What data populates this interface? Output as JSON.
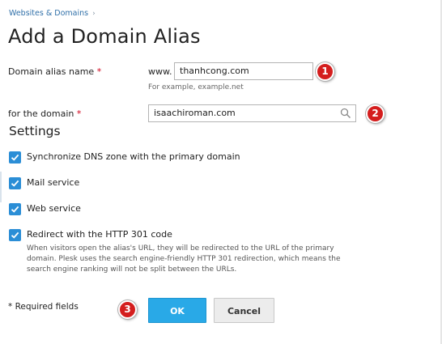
{
  "breadcrumb": {
    "item": "Websites & Domains",
    "separator": "›"
  },
  "page_title": "Add a Domain Alias",
  "alias_field": {
    "label": "Domain alias name",
    "required_mark": "*",
    "prefix": "www.",
    "value": "thanhcong.com",
    "hint": "For example, example.net"
  },
  "domain_field": {
    "label": "for the domain",
    "required_mark": "*",
    "value": "isaachiroman.com",
    "icon": "search-icon"
  },
  "settings": {
    "title": "Settings",
    "options": [
      {
        "label": "Synchronize DNS zone with the primary domain",
        "checked": true
      },
      {
        "label": "Mail service",
        "checked": true
      },
      {
        "label": "Web service",
        "checked": true
      },
      {
        "label": "Redirect with the HTTP 301 code",
        "checked": true
      }
    ],
    "redirect_description": "When visitors open the alias's URL, they will be redirected to the URL of the primary domain. Plesk uses the search engine-friendly HTTP 301 redirection, which means the search engine ranking will not be split between the URLs."
  },
  "footer": {
    "required_note": "* Required fields",
    "ok_label": "OK",
    "cancel_label": "Cancel"
  },
  "annotations": [
    "1",
    "2",
    "3"
  ],
  "colors": {
    "link": "#2f6fa8",
    "checkbox": "#2b8ed6",
    "primary_button": "#29a9e7",
    "badge": "#d41e1e",
    "required": "#d0021b"
  }
}
